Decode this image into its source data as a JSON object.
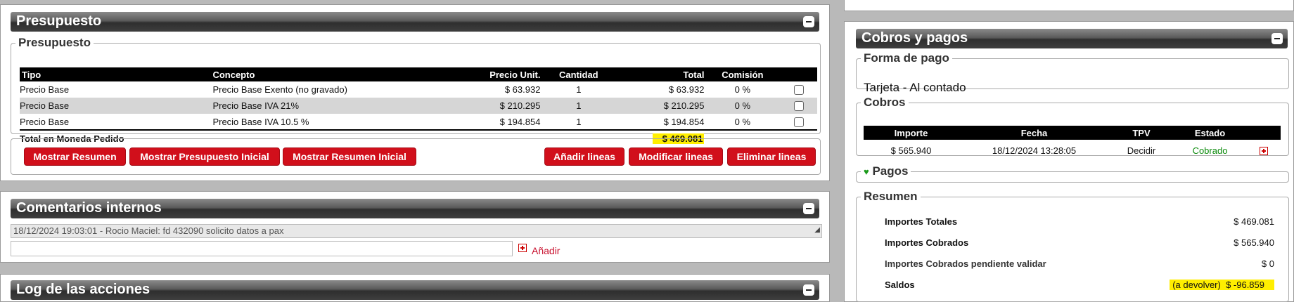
{
  "presupuesto": {
    "title": "Presupuesto",
    "legend": "Presupuesto",
    "columns": [
      "Tipo",
      "Concepto",
      "Precio Unit.",
      "Cantidad",
      "Total",
      "Comisión"
    ],
    "rows": [
      {
        "tipo": "Precio Base",
        "concepto": "Precio Base Exento (no gravado)",
        "precio": "$ 63.932",
        "cantidad": "1",
        "total": "$ 63.932",
        "comision": "0 %"
      },
      {
        "tipo": "Precio Base",
        "concepto": "Precio Base IVA 21%",
        "precio": "$ 210.295",
        "cantidad": "1",
        "total": "$ 210.295",
        "comision": "0 %"
      },
      {
        "tipo": "Precio Base",
        "concepto": "Precio Base IVA 10.5 %",
        "precio": "$ 194.854",
        "cantidad": "1",
        "total": "$ 194.854",
        "comision": "0 %"
      }
    ],
    "total_label": "Total en Moneda Pedido",
    "total_value": "$ 469.081",
    "buttons": {
      "mostrar_resumen": "Mostrar Resumen",
      "mostrar_presupuesto_inicial": "Mostrar Presupuesto Inicial",
      "mostrar_resumen_inicial": "Mostrar Resumen Inicial",
      "anadir_lineas": "Añadir lineas",
      "modificar_lineas": "Modificar lineas",
      "eliminar_lineas": "Eliminar lineas"
    }
  },
  "comentarios": {
    "title": "Comentarios internos",
    "entry": "18/12/2024 19:03:01 - Rocio Maciel: fd 432090 solicito datos a pax",
    "input_value": "",
    "add_label": "Añadir"
  },
  "log": {
    "title": "Log de las acciones"
  },
  "cobros_pagos": {
    "title": "Cobros y pagos",
    "forma_pago_legend": "Forma de pago",
    "forma_pago_value": "Tarjeta - Al contado",
    "cobros_legend": "Cobros",
    "cobros_columns": [
      "Importe",
      "Fecha",
      "TPV",
      "Estado"
    ],
    "cobros_rows": [
      {
        "importe": "$ 565.940",
        "fecha": "18/12/2024 13:28:05",
        "tpv": "Decidir",
        "estado": "Cobrado"
      }
    ],
    "pagos_legend": "Pagos",
    "resumen_legend": "Resumen",
    "resumen": [
      {
        "label": "Importes Totales",
        "value": "$ 469.081"
      },
      {
        "label": "Importes Cobrados",
        "value": "$ 565.940"
      },
      {
        "label": "Importes Cobrados pendiente validar",
        "value": "$ 0"
      },
      {
        "label": "Saldos",
        "value": "(a devolver)  $ -96.859"
      }
    ]
  },
  "colors": {
    "header_bar": "#3e3e3e",
    "button_red": "#d10f1b",
    "highlight_yellow": "#ffee00",
    "cobrado_green": "#0a8a0a"
  }
}
